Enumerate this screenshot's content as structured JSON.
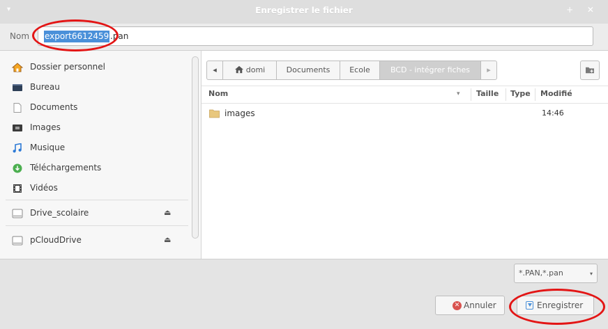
{
  "window": {
    "title": "Enregistrer le fichier",
    "menu_glyph": "▾",
    "controls_glyph": "+ ✕"
  },
  "name_field": {
    "label": "Nom :",
    "value_selected": "export6612459",
    "value_rest": ".pan"
  },
  "sidebar": {
    "items": [
      {
        "label": "Dossier personnel"
      },
      {
        "label": "Bureau"
      },
      {
        "label": "Documents"
      },
      {
        "label": "Images"
      },
      {
        "label": "Musique"
      },
      {
        "label": "Téléchargements"
      },
      {
        "label": "Vidéos"
      }
    ],
    "drives": [
      {
        "label": "Drive_scolaire",
        "eject": "⏏"
      },
      {
        "label": "pCloudDrive",
        "eject": "⏏"
      }
    ]
  },
  "pathbar": {
    "back": "◂",
    "home": "domi",
    "segments": [
      "Documents",
      "Ecole",
      "BCD - intégrer fiches"
    ],
    "forward": "▸"
  },
  "columns": {
    "name": "Nom",
    "sort_indicator": "▾",
    "size": "Taille",
    "type": "Type",
    "modified": "Modifié"
  },
  "files": [
    {
      "name": "images",
      "modified": "14:46"
    }
  ],
  "filter": {
    "value": "*.PAN,*.pan",
    "arrow": "▾"
  },
  "buttons": {
    "cancel": "Annuler",
    "cancel_icon": "✕",
    "save": "Enregistrer"
  },
  "colors": {
    "selection": "#4a90d9",
    "annotation": "#e31515",
    "folder": "#e8c77d"
  }
}
